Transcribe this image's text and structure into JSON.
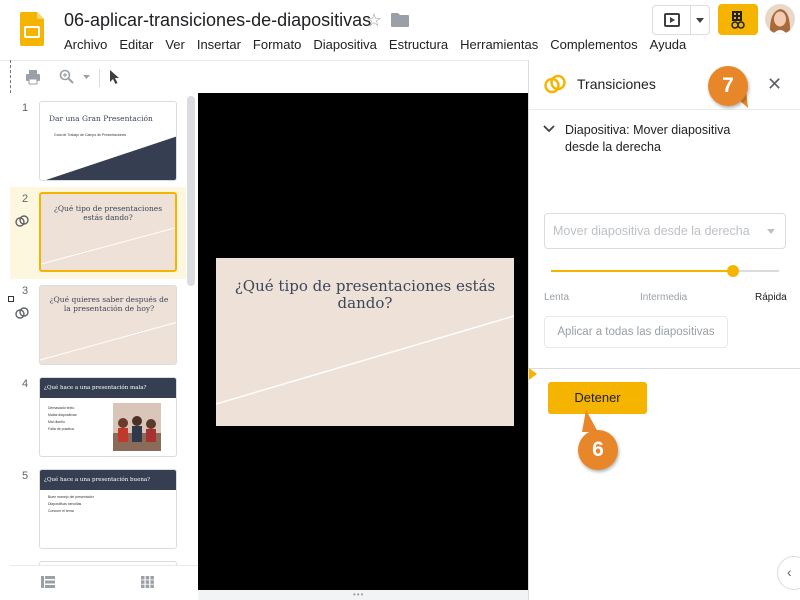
{
  "app": {
    "doc_title": "06-aplicar-transiciones-de-diapositivas",
    "menu": [
      "Archivo",
      "Editar",
      "Ver",
      "Insertar",
      "Formato",
      "Diapositiva",
      "Estructura",
      "Herramientas",
      "Complementos",
      "Ayuda"
    ],
    "accent_color": "#f4b400"
  },
  "filmstrip": {
    "slides": [
      {
        "number": "1",
        "title": "Dar una Gran Presentación",
        "subtitle": "Guía de Trabajo de Campo de Presentaciones",
        "has_transition": false,
        "selected": false
      },
      {
        "number": "2",
        "title": "¿Qué tipo de presentaciones estás dando?",
        "has_transition": true,
        "selected": true
      },
      {
        "number": "3",
        "title": "¿Qué quieres saber después de la presentación de hoy?",
        "has_transition": true,
        "selected": false
      },
      {
        "number": "4",
        "title": "¿Qué hace a una presentación mala?",
        "bullets": [
          "Demasiado texto",
          "Malas diapositivas",
          "Mal diseño",
          "Falta de practica"
        ],
        "has_transition": false,
        "selected": false
      },
      {
        "number": "5",
        "title": "¿Qué hace a una presentación buena?",
        "bullets": [
          "Buen manejo del presentador",
          "Diapositivas sencillas",
          "Conocer el tema"
        ],
        "has_transition": false,
        "selected": false
      }
    ]
  },
  "main_slide": {
    "title": "¿Qué tipo de presentaciones estás dando?"
  },
  "transitions_panel": {
    "title": "Transiciones",
    "section_label": "Diapositiva: Mover diapositiva desde la derecha",
    "select_value": "Mover diapositiva desde la derecha",
    "speed": {
      "fraction": 0.8,
      "slow_label": "Lenta",
      "medium_label": "Intermedia",
      "fast_label": "Rápida"
    },
    "apply_all_label": "Aplicar a todas las diapositivas",
    "stop_label": "Detener"
  },
  "callouts": {
    "stop": "6",
    "close": "7"
  }
}
